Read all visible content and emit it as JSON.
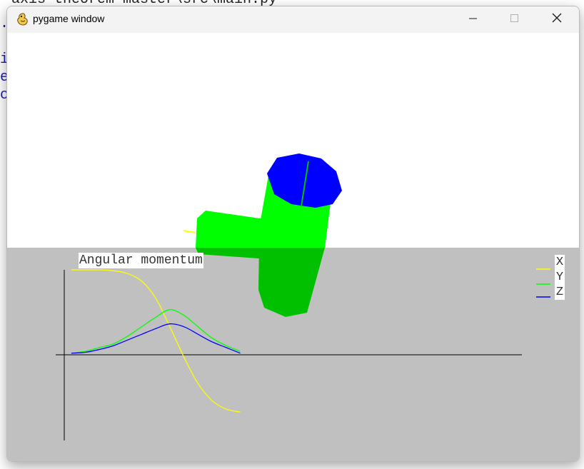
{
  "background": {
    "top_line": "-axis-theorem-master\\src\\main.py",
    "side_lines": [
      ".",
      "i",
      "e",
      "c"
    ]
  },
  "window": {
    "title": "pygame window",
    "icon": "pygame-snake-icon",
    "controls": {
      "minimize_icon": "minimize-icon",
      "maximize_icon": "maximize-icon",
      "close_icon": "close-icon"
    }
  },
  "scene": {
    "sky_color": "#ffffff",
    "ground_color": "#c0c0c0",
    "body_color": "#00ff00",
    "body_shadow_color": "#00c000",
    "cap_color": "#0000ff"
  },
  "chart_data": {
    "type": "line",
    "title": "Angular momentum",
    "legend_position": "top-right",
    "series": [
      {
        "name": "X",
        "color": "#ffff00",
        "values": [
          [
            0,
            0.45
          ],
          [
            0.1,
            0.45
          ],
          [
            0.2,
            0.45
          ],
          [
            0.3,
            0.445
          ],
          [
            0.4,
            0.43
          ],
          [
            0.5,
            0.39
          ],
          [
            0.6,
            0.3
          ],
          [
            0.7,
            0.15
          ],
          [
            0.8,
            -0.01
          ],
          [
            0.9,
            -0.15
          ],
          [
            1.0,
            -0.24
          ],
          [
            1.1,
            -0.285
          ],
          [
            1.2,
            -0.3
          ]
        ]
      },
      {
        "name": "Y",
        "color": "#00ff00",
        "values": [
          [
            0,
            0.01
          ],
          [
            0.1,
            0.02
          ],
          [
            0.2,
            0.04
          ],
          [
            0.3,
            0.06
          ],
          [
            0.4,
            0.1
          ],
          [
            0.5,
            0.15
          ],
          [
            0.6,
            0.2
          ],
          [
            0.7,
            0.24
          ],
          [
            0.8,
            0.21
          ],
          [
            0.9,
            0.15
          ],
          [
            1.0,
            0.09
          ],
          [
            1.1,
            0.05
          ],
          [
            1.2,
            0.02
          ]
        ]
      },
      {
        "name": "Z",
        "color": "#0000ff",
        "values": [
          [
            0,
            0.01
          ],
          [
            0.1,
            0.015
          ],
          [
            0.2,
            0.03
          ],
          [
            0.3,
            0.05
          ],
          [
            0.4,
            0.08
          ],
          [
            0.5,
            0.11
          ],
          [
            0.6,
            0.14
          ],
          [
            0.7,
            0.165
          ],
          [
            0.8,
            0.15
          ],
          [
            0.9,
            0.11
          ],
          [
            1.0,
            0.07
          ],
          [
            1.1,
            0.04
          ],
          [
            1.2,
            0.01
          ]
        ]
      }
    ],
    "xlim": [
      -0.05,
      3.2
    ],
    "ylim": [
      -0.45,
      0.45
    ],
    "grid": false
  }
}
